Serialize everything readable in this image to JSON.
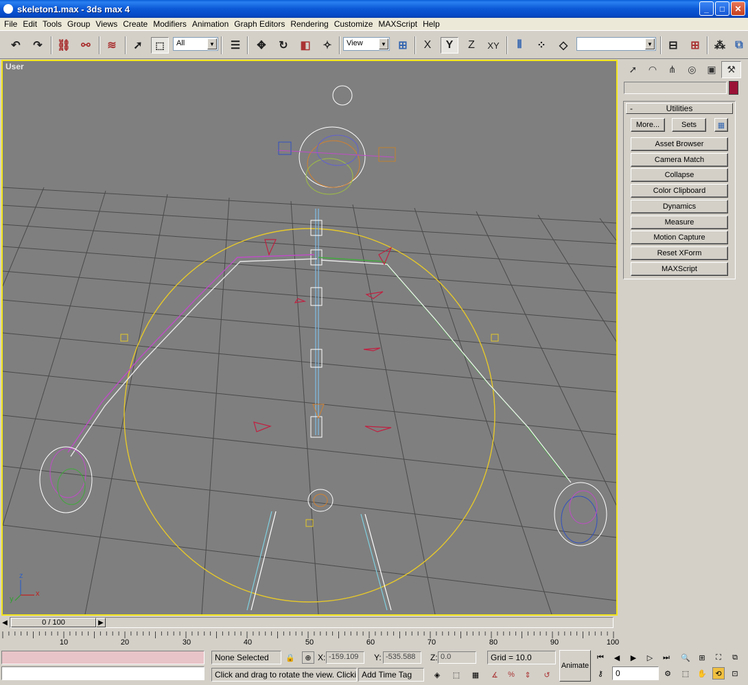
{
  "window": {
    "app_icon": "max-icon",
    "title": "skeleton1.max - 3ds max 4",
    "min_glyph": "_",
    "max_glyph": "□",
    "close_glyph": "✕"
  },
  "menu": [
    "File",
    "Edit",
    "Tools",
    "Group",
    "Views",
    "Create",
    "Modifiers",
    "Animation",
    "Graph Editors",
    "Rendering",
    "Customize",
    "MAXScript",
    "Help"
  ],
  "toolbar": {
    "selection_filter": "All",
    "ref_coord": "View",
    "axis_x": "X",
    "axis_y": "Y",
    "axis_z": "Z",
    "axis_xy": "XY",
    "named_selection": ""
  },
  "viewport": {
    "label": "User",
    "axis_z": "z",
    "axis_x": "x",
    "axis_y": "y",
    "border_color": "#f3e51b",
    "bg_color": "#7f7f7f"
  },
  "command_panel": {
    "active_tab": "utilities",
    "rollout_title": "Utilities",
    "rollout_toggle": "-",
    "more_button": "More...",
    "sets_button": "Sets",
    "object_color": "#9a1236",
    "utilities": [
      "Asset Browser",
      "Camera Match",
      "Collapse",
      "Color Clipboard",
      "Dynamics",
      "Measure",
      "Motion Capture",
      "Reset XForm",
      "MAXScript"
    ]
  },
  "timeline": {
    "frame_display": "0 / 100",
    "ticks": [
      "10",
      "20",
      "30",
      "40",
      "50",
      "60",
      "70",
      "80",
      "90",
      "100"
    ]
  },
  "status": {
    "selection": "None Selected",
    "x_label": "X:",
    "x_value": "-159.109",
    "y_label": "Y:",
    "y_value": "-535.588",
    "z_label": "Z:",
    "z_value": "0.0",
    "grid": "Grid = 10.0",
    "prompt": "Click and drag to rotate the view.  Clicking i",
    "add_time_tag": "Add Time Tag",
    "animate_button": "Animate",
    "current_frame": "0"
  }
}
